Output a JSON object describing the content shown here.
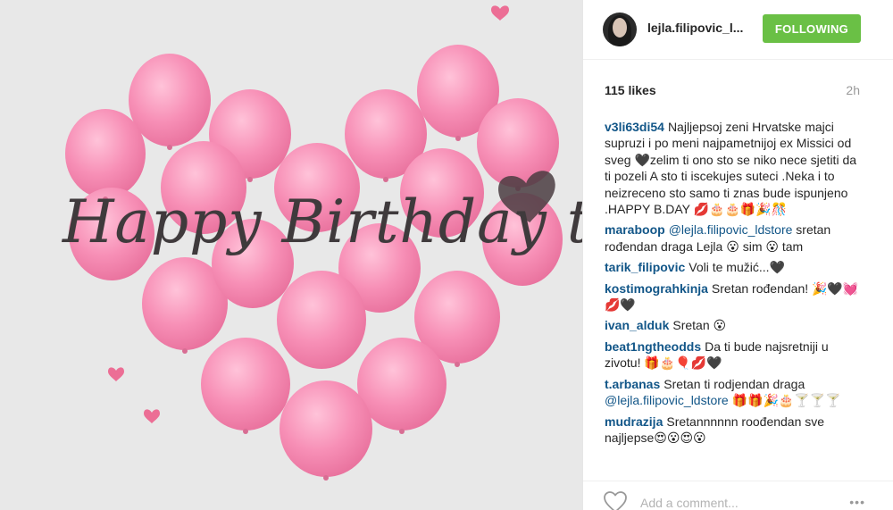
{
  "photo": {
    "caption": "Happy Birthday to me",
    "balloon_color": "#f58bb1",
    "background": "#e8e8e8"
  },
  "header": {
    "username": "lejla.filipovic_l...",
    "follow_label": "FOLLOWING",
    "follow_color": "#6ac045"
  },
  "stats": {
    "likes": "115 likes",
    "time": "2h"
  },
  "comments": [
    {
      "user": "v3li63di54",
      "text": "Najljepsoj zeni Hrvatske majci supruzi i po meni najpametnijoj ex Missici od sveg 🖤zelim ti ono sto se niko nece sjetiti da ti pozeli A sto ti iscekujes suteci .Neka i to neizreceno sto samo ti znas bude ispunjeno .HAPPY B.DAY 💋🎂🎂🎁🎉🎊"
    },
    {
      "user": "maraboop",
      "mention": "@lejla.filipovic_ldstore",
      "text": "sretan rođendan draga Lejla 😮 sim 😮 tam"
    },
    {
      "user": "tarik_filipovic",
      "text": "Voli te mužić...🖤"
    },
    {
      "user": "kostimograhkinja",
      "text": "Sretan rođendan! 🎉🖤💓💋🖤"
    },
    {
      "user": "ivan_alduk",
      "text": "Sretan 😮"
    },
    {
      "user": "beat1ngtheodds",
      "text": "Da ti bude najsretniji u zivotu! 🎁🎂🎈💋🖤"
    },
    {
      "user": "t.arbanas",
      "text": "Sretan ti rodjendan draga",
      "mention": "@lejla.filipovic_ldstore",
      "suffix": "🎁🎁🎉🎂🍸🍸🍸"
    },
    {
      "user": "mudrazija",
      "text": "Sretannnnnn roođendan sve najljepse😍😮😍😮"
    }
  ],
  "footer": {
    "comment_placeholder": "Add a comment...",
    "more_label": "•••"
  }
}
